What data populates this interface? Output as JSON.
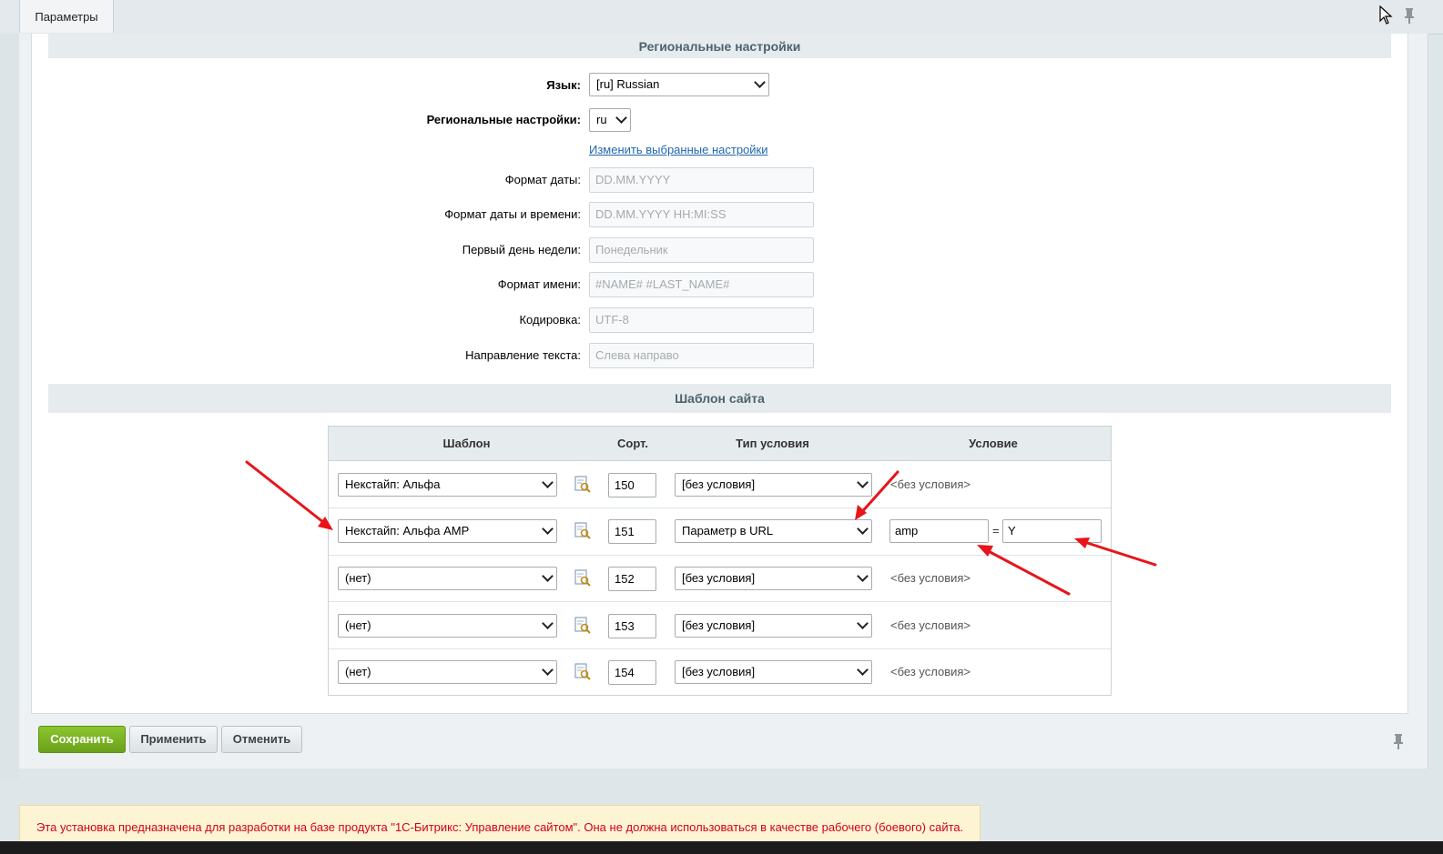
{
  "tab": {
    "label": "Параметры"
  },
  "regional": {
    "section_title": "Региональные настройки",
    "language": {
      "label": "Язык:",
      "value": "[ru] Russian"
    },
    "culture": {
      "label": "Региональные настройки:",
      "value": "ru"
    },
    "change_link": "Изменить выбранные настройки",
    "fields": [
      {
        "label": "Формат даты:",
        "value": "DD.MM.YYYY"
      },
      {
        "label": "Формат даты и времени:",
        "value": "DD.MM.YYYY HH:MI:SS"
      },
      {
        "label": "Первый день недели:",
        "value": "Понедельник"
      },
      {
        "label": "Формат имени:",
        "value": "#NAME# #LAST_NAME#"
      },
      {
        "label": "Кодировка:",
        "value": "UTF-8"
      },
      {
        "label": "Направление текста:",
        "value": "Слева направо"
      }
    ]
  },
  "templates": {
    "section_title": "Шаблон сайта",
    "headers": [
      "Шаблон",
      "Сорт.",
      "Тип условия",
      "Условие"
    ],
    "rows": [
      {
        "template": "Некстайп: Альфа",
        "sort": "150",
        "condition_type": "[без условия]",
        "condition": "<без условия>"
      },
      {
        "template": "Некстайп: Альфа AMP",
        "sort": "151",
        "condition_type": "Параметр в URL",
        "param_name": "amp",
        "eq": "=",
        "param_value": "Y"
      },
      {
        "template": "(нет)",
        "sort": "152",
        "condition_type": "[без условия]",
        "condition": "<без условия>"
      },
      {
        "template": "(нет)",
        "sort": "153",
        "condition_type": "[без условия]",
        "condition": "<без условия>"
      },
      {
        "template": "(нет)",
        "sort": "154",
        "condition_type": "[без условия]",
        "condition": "<без условия>"
      }
    ]
  },
  "buttons": {
    "save": "Сохранить",
    "apply": "Применить",
    "cancel": "Отменить"
  },
  "notice": "Эта установка предназначена для разработки на базе продукта \"1С-Битрикс: Управление сайтом\". Она не должна использоваться в качестве рабочего (боевого) сайта.",
  "colors": {
    "accent_green": "#7ab32a",
    "link": "#2067b0",
    "notice_text": "#d0021b",
    "annotation_arrow": "#e8141a"
  }
}
